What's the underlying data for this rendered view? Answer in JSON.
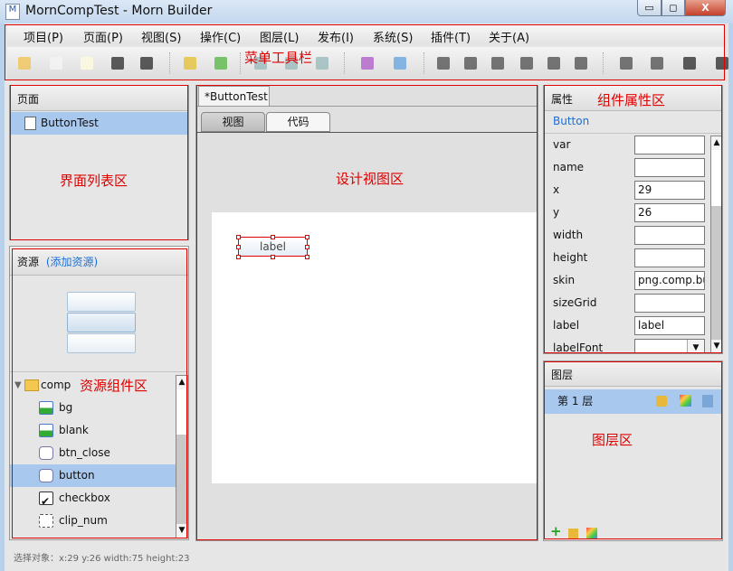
{
  "window": {
    "title": "MornCompTest - Morn Builder",
    "minimize": "▭",
    "maximize": "◻",
    "close": "X"
  },
  "menu": [
    "项目(P)",
    "页面(P)",
    "视图(S)",
    "操作(C)",
    "图层(L)",
    "发布(I)",
    "系统(S)",
    "插件(T)",
    "关于(A)"
  ],
  "annotations": {
    "menu_toolbar": "菜单工具栏",
    "page_list": "界面列表区",
    "design_view": "设计视图区",
    "resources": "资源组件区",
    "properties": "组件属性区",
    "layers": "图层区"
  },
  "pages": {
    "header": "页面",
    "items": [
      "ButtonTest"
    ]
  },
  "resources": {
    "header": "资源",
    "add_link": "(添加资源)",
    "folder": "comp",
    "items": [
      {
        "name": "bg",
        "icon": "image-icon"
      },
      {
        "name": "blank",
        "icon": "image-icon"
      },
      {
        "name": "btn_close",
        "icon": "button-icon"
      },
      {
        "name": "button",
        "icon": "button-icon",
        "selected": true
      },
      {
        "name": "checkbox",
        "icon": "checkbox-icon"
      },
      {
        "name": "clip_num",
        "icon": "clip-icon"
      }
    ]
  },
  "editor": {
    "tab": "*ButtonTest",
    "subtabs": [
      "视图",
      "代码"
    ],
    "component_label": "label"
  },
  "properties": {
    "header": "属性",
    "component": "Button",
    "rows": [
      {
        "name": "var",
        "value": ""
      },
      {
        "name": "name",
        "value": ""
      },
      {
        "name": "x",
        "value": "29"
      },
      {
        "name": "y",
        "value": "26"
      },
      {
        "name": "width",
        "value": ""
      },
      {
        "name": "height",
        "value": ""
      },
      {
        "name": "skin",
        "value": "png.comp.button"
      },
      {
        "name": "sizeGrid",
        "value": ""
      },
      {
        "name": "label",
        "value": "label"
      },
      {
        "name": "labelFont",
        "value": ""
      }
    ]
  },
  "layers": {
    "header": "图层",
    "items": [
      "第 1 层"
    ]
  },
  "status": "选择对象：x:29 y:26  width:75 height:23",
  "colors": {
    "selection": "#a9c8ee",
    "link": "#1a6fd6",
    "annotation": "#e00000"
  }
}
